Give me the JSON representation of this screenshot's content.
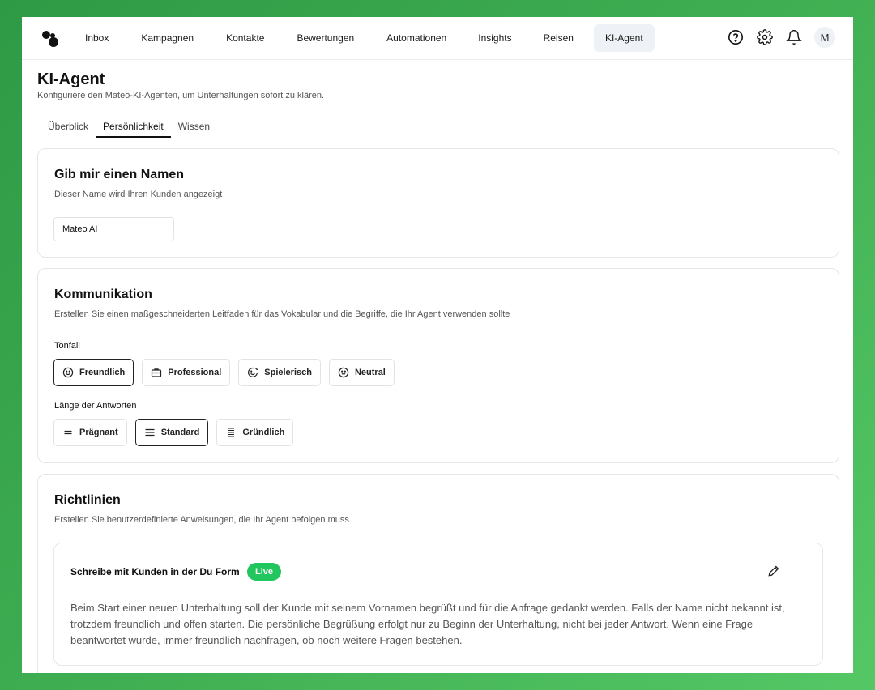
{
  "nav": {
    "items": [
      "Inbox",
      "Kampagnen",
      "Kontakte",
      "Bewertungen",
      "Automationen",
      "Insights",
      "Reisen",
      "KI-Agent"
    ],
    "active": "KI-Agent",
    "icons": [
      "help-icon",
      "gear-icon",
      "bell-icon"
    ],
    "avatar": "M"
  },
  "header": {
    "title": "KI-Agent",
    "subtitle": "Konfiguriere den Mateo-KI-Agenten, um Unterhaltungen sofort zu klären.",
    "tabs": [
      "Überblick",
      "Persönlichkeit",
      "Wissen"
    ],
    "active_tab": "Persönlichkeit"
  },
  "name_card": {
    "title": "Gib mir einen Namen",
    "subtitle": "Dieser Name wird Ihren Kunden angezeigt",
    "value": "Mateo AI"
  },
  "communication": {
    "title": "Kommunikation",
    "subtitle": "Erstellen Sie einen maßgeschneiderten Leitfaden für das Vokabular und die Begriffe, die Ihr Agent verwenden sollte",
    "tone_label": "Tonfall",
    "tones": [
      {
        "label": "Freundlich",
        "icon": "smile-icon",
        "selected": true
      },
      {
        "label": "Professional",
        "icon": "briefcase-icon",
        "selected": false
      },
      {
        "label": "Spielerisch",
        "icon": "playful-icon",
        "selected": false
      },
      {
        "label": "Neutral",
        "icon": "neutral-face-icon",
        "selected": false
      }
    ],
    "length_label": "Länge der Antworten",
    "lengths": [
      {
        "label": "Prägnant",
        "icon": "short-lines-icon",
        "selected": false
      },
      {
        "label": "Standard",
        "icon": "menu-lines-icon",
        "selected": true
      },
      {
        "label": "Gründlich",
        "icon": "many-lines-icon",
        "selected": false
      }
    ]
  },
  "guidelines": {
    "title": "Richtlinien",
    "subtitle": "Erstellen Sie benutzerdefinierte Anweisungen, die Ihr Agent befolgen muss",
    "item": {
      "title": "Schreibe mit Kunden in der Du Form",
      "badge": "Live",
      "body": "Beim Start einer neuen Unterhaltung soll der Kunde mit seinem Vornamen begrüßt und für die Anfrage gedankt werden. Falls der Name nicht bekannt ist, trotzdem freundlich und offen starten. Die persönliche Begrüßung erfolgt nur zu Beginn der Unterhaltung, nicht bei jeder Antwort. Wenn eine Frage beantwortet wurde, immer freundlich nachfragen, ob noch weitere Fragen bestehen."
    }
  },
  "colors": {
    "background": "#3fae52",
    "badge": "#22c55e",
    "active_nav": "#eef2f6"
  }
}
